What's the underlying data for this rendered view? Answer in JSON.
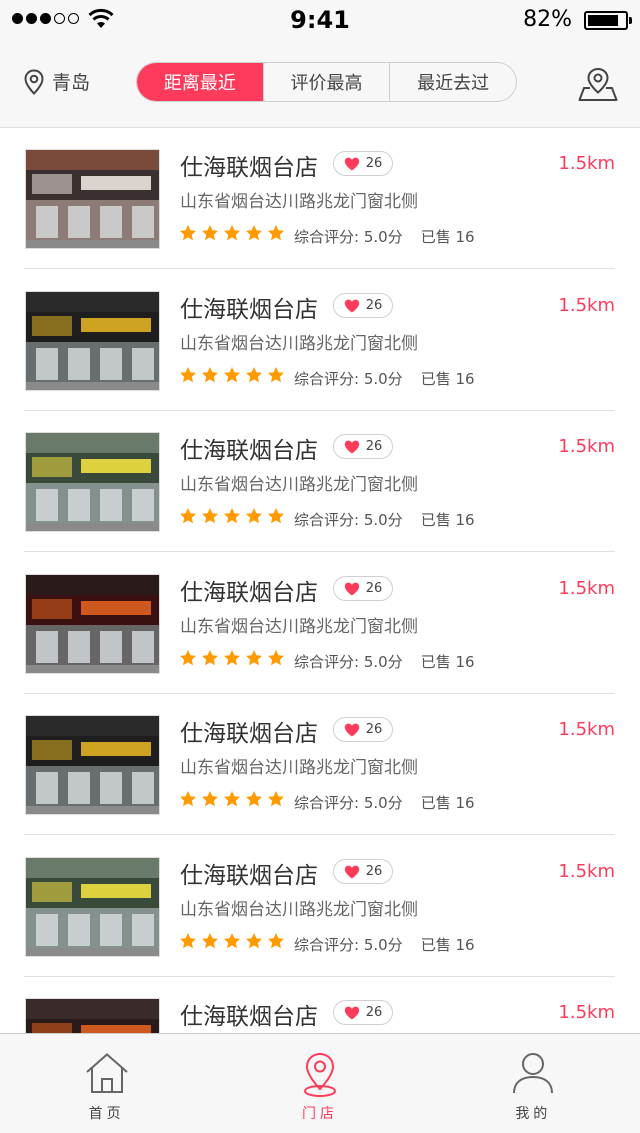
{
  "status_bar": {
    "time": "9:41",
    "battery_percent": "82%",
    "battery_level": 0.82,
    "signal_bars_filled": 3,
    "signal_bars_total": 5
  },
  "header": {
    "city": "青岛",
    "location_icon": "location-pin-icon",
    "map_icon": "map-pin-icon",
    "accent_color": "#ff3b5c",
    "sort_tabs": [
      {
        "label": "距离最近",
        "active": true
      },
      {
        "label": "评价最高",
        "active": false
      },
      {
        "label": "最近去过",
        "active": false
      }
    ]
  },
  "stores": [
    {
      "name": "仕海联烟台店",
      "likes": "26",
      "distance": "1.5km",
      "address": "山东省烟台达川路兆龙门窗北侧",
      "rating": "综合评分: 5.0分",
      "sold": "已售 16",
      "stars": 5
    },
    {
      "name": "仕海联烟台店",
      "likes": "26",
      "distance": "1.5km",
      "address": "山东省烟台达川路兆龙门窗北侧",
      "rating": "综合评分: 5.0分",
      "sold": "已售 16",
      "stars": 5
    },
    {
      "name": "仕海联烟台店",
      "likes": "26",
      "distance": "1.5km",
      "address": "山东省烟台达川路兆龙门窗北侧",
      "rating": "综合评分: 5.0分",
      "sold": "已售 16",
      "stars": 5
    },
    {
      "name": "仕海联烟台店",
      "likes": "26",
      "distance": "1.5km",
      "address": "山东省烟台达川路兆龙门窗北侧",
      "rating": "综合评分: 5.0分",
      "sold": "已售 16",
      "stars": 5
    },
    {
      "name": "仕海联烟台店",
      "likes": "26",
      "distance": "1.5km",
      "address": "山东省烟台达川路兆龙门窗北侧",
      "rating": "综合评分: 5.0分",
      "sold": "已售 16",
      "stars": 5
    },
    {
      "name": "仕海联烟台店",
      "likes": "26",
      "distance": "1.5km",
      "address": "山东省烟台达川路兆龙门窗北侧",
      "rating": "综合评分: 5.0分",
      "sold": "已售 16",
      "stars": 5
    },
    {
      "name": "仕海联烟台店",
      "likes": "26",
      "distance": "1.5km",
      "address": "",
      "rating": "",
      "sold": "",
      "stars": 0
    }
  ],
  "tab_bar": {
    "items": [
      {
        "label": "首页",
        "icon": "home-icon",
        "active": false
      },
      {
        "label": "门店",
        "icon": "store-location-icon",
        "active": true
      },
      {
        "label": "我的",
        "icon": "profile-icon",
        "active": false
      }
    ]
  }
}
